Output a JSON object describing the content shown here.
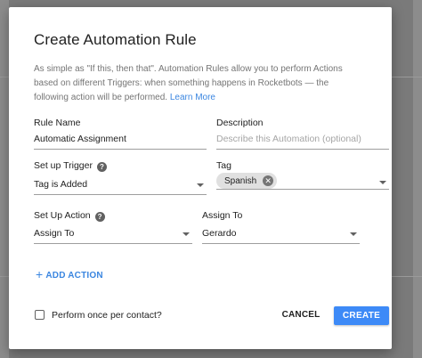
{
  "dialog": {
    "title": "Create Automation Rule",
    "description": "As simple as \"If this, then that\". Automation Rules allow you to perform Actions based on different Triggers: when something happens in Rocketbots — the following action will be performed.",
    "learn_more": "Learn More"
  },
  "rule_name": {
    "label": "Rule Name",
    "value": "Automatic Assignment"
  },
  "description_field": {
    "label": "Description",
    "placeholder": "Describe this Automation (optional)"
  },
  "trigger": {
    "label": "Set up Trigger",
    "value": "Tag is Added"
  },
  "tag": {
    "label": "Tag",
    "chip": "Spanish"
  },
  "action": {
    "label": "Set Up Action",
    "value": "Assign To"
  },
  "assign_to": {
    "label": "Assign To",
    "value": "Gerardo"
  },
  "add_action": "ADD ACTION",
  "perform_once": "Perform once per contact?",
  "buttons": {
    "cancel": "CANCEL",
    "create": "CREATE"
  },
  "colors": {
    "accent": "#3d8af7",
    "link": "#3b86e0"
  }
}
